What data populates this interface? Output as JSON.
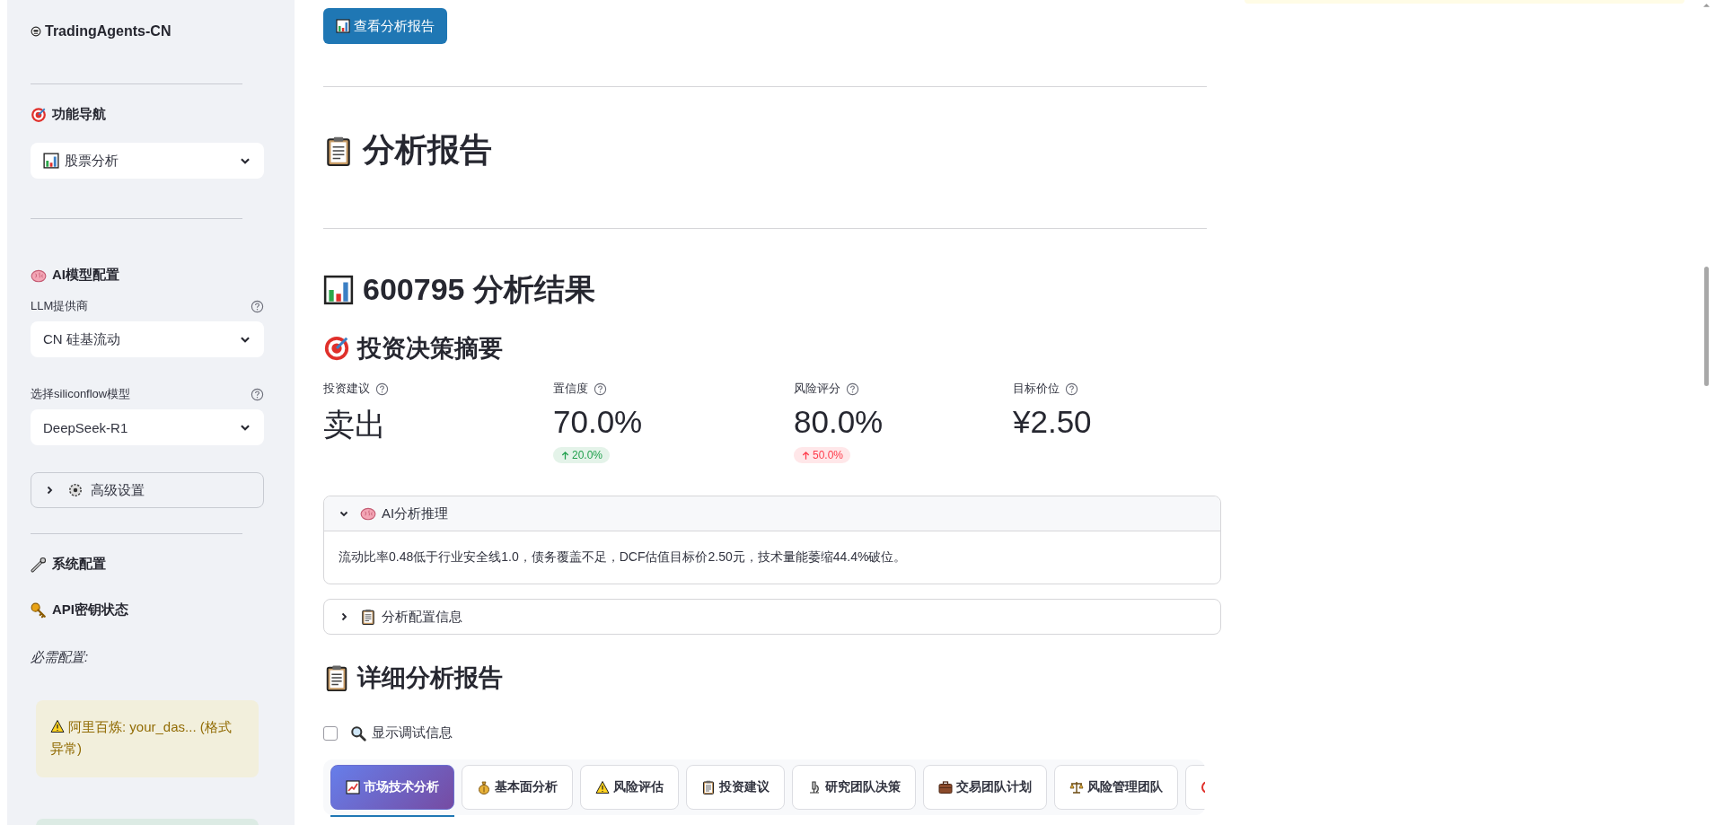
{
  "sidebar": {
    "title": "TradingAgents-CN",
    "navigation": {
      "heading": "功能导航",
      "select": {
        "value": "股票分析"
      }
    },
    "model_config": {
      "heading": "AI模型配置",
      "provider": {
        "label": "LLM提供商",
        "value": "CN 硅基流动"
      },
      "model": {
        "label": "选择siliconflow模型",
        "value": "DeepSeek-R1"
      },
      "advanced": {
        "label": "高级设置",
        "expanded": false
      }
    },
    "system_config": {
      "heading": "系统配置"
    },
    "api_keys": {
      "heading": "API密钥状态",
      "required_label": "必需配置:",
      "alerts": [
        {
          "kind": "warning",
          "text": "阿里百炼: your_das... (格式异常)"
        },
        {
          "kind": "success"
        }
      ]
    }
  },
  "main": {
    "view_report_button": "查看分析报告",
    "report_heading": "分析报告",
    "result_heading": "600795 分析结果",
    "summary_heading": "投资决策摘要",
    "metrics": [
      {
        "label": "投资建议",
        "value": "卖出"
      },
      {
        "label": "置信度",
        "value": "70.0%",
        "delta": "20.0%",
        "color": "#21a04d"
      },
      {
        "label": "风险评分",
        "value": "80.0%",
        "delta": "50.0%",
        "color": "#ff3b4b"
      },
      {
        "label": "目标价位",
        "value": "¥2.50"
      }
    ],
    "expanders": [
      {
        "label": "AI分析推理",
        "expanded": true,
        "body": "流动比率0.48低于行业安全线1.0，债务覆盖不足，DCF估值目标价2.50元，技术量能萎缩44.4%破位。"
      },
      {
        "label": "分析配置信息",
        "expanded": false
      }
    ],
    "detail_heading": "详细分析报告",
    "debug_checkbox": {
      "label": "显示调试信息",
      "checked": false
    },
    "tabs": [
      {
        "label": "市场技术分析",
        "selected": true
      },
      {
        "label": "基本面分析",
        "selected": false
      },
      {
        "label": "风险评估",
        "selected": false
      },
      {
        "label": "投资建议",
        "selected": false
      },
      {
        "label": "研究团队决策",
        "selected": false
      },
      {
        "label": "交易团队计划",
        "selected": false
      },
      {
        "label": "风险管理团队",
        "selected": false
      },
      {
        "selected": false
      }
    ]
  }
}
